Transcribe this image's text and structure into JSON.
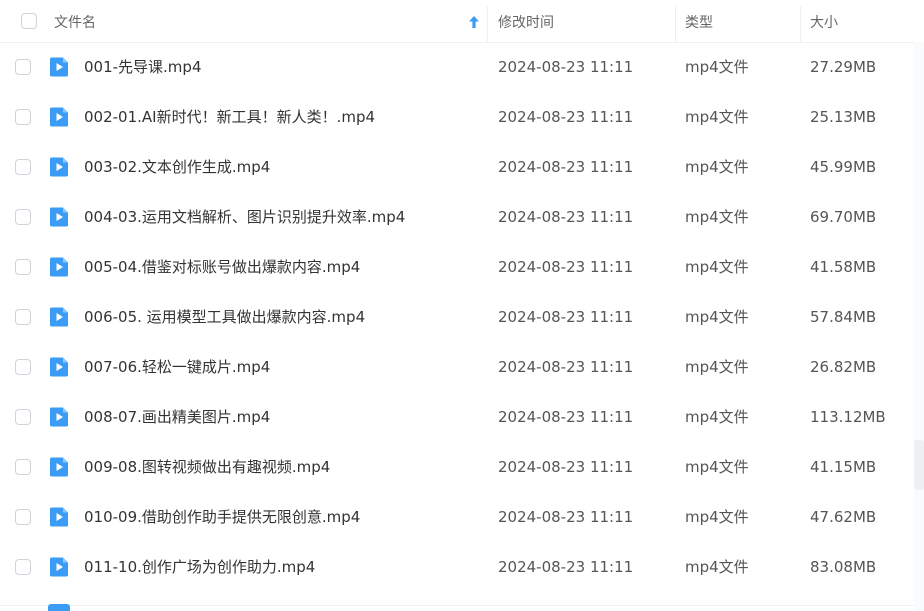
{
  "header": {
    "name": "文件名",
    "modified": "修改时间",
    "type": "类型",
    "size": "大小"
  },
  "icons": {
    "sort": "sort-ascending-arrow-icon",
    "file": "video-file-play-icon"
  },
  "colors": {
    "accent": "#3b9cf5"
  },
  "files": [
    {
      "name": "001-先导课.mp4",
      "modified": "2024-08-23 11:11",
      "type": "mp4文件",
      "size": "27.29MB"
    },
    {
      "name": "002-01.AI新时代！新工具！新人类！.mp4",
      "modified": "2024-08-23 11:11",
      "type": "mp4文件",
      "size": "25.13MB"
    },
    {
      "name": "003-02.文本创作生成.mp4",
      "modified": "2024-08-23 11:11",
      "type": "mp4文件",
      "size": "45.99MB"
    },
    {
      "name": "004-03.运用文档解析、图片识别提升效率.mp4",
      "modified": "2024-08-23 11:11",
      "type": "mp4文件",
      "size": "69.70MB"
    },
    {
      "name": "005-04.借鉴对标账号做出爆款内容.mp4",
      "modified": "2024-08-23 11:11",
      "type": "mp4文件",
      "size": "41.58MB"
    },
    {
      "name": "006-05. 运用模型工具做出爆款内容.mp4",
      "modified": "2024-08-23 11:11",
      "type": "mp4文件",
      "size": "57.84MB"
    },
    {
      "name": "007-06.轻松一键成片.mp4",
      "modified": "2024-08-23 11:11",
      "type": "mp4文件",
      "size": "26.82MB"
    },
    {
      "name": "008-07.画出精美图片.mp4",
      "modified": "2024-08-23 11:11",
      "type": "mp4文件",
      "size": "113.12MB"
    },
    {
      "name": "009-08.图转视频做出有趣视频.mp4",
      "modified": "2024-08-23 11:11",
      "type": "mp4文件",
      "size": "41.15MB"
    },
    {
      "name": "010-09.借助创作助手提供无限创意.mp4",
      "modified": "2024-08-23 11:11",
      "type": "mp4文件",
      "size": "47.62MB"
    },
    {
      "name": "011-10.创作广场为创作助力.mp4",
      "modified": "2024-08-23 11:11",
      "type": "mp4文件",
      "size": "83.08MB"
    }
  ]
}
